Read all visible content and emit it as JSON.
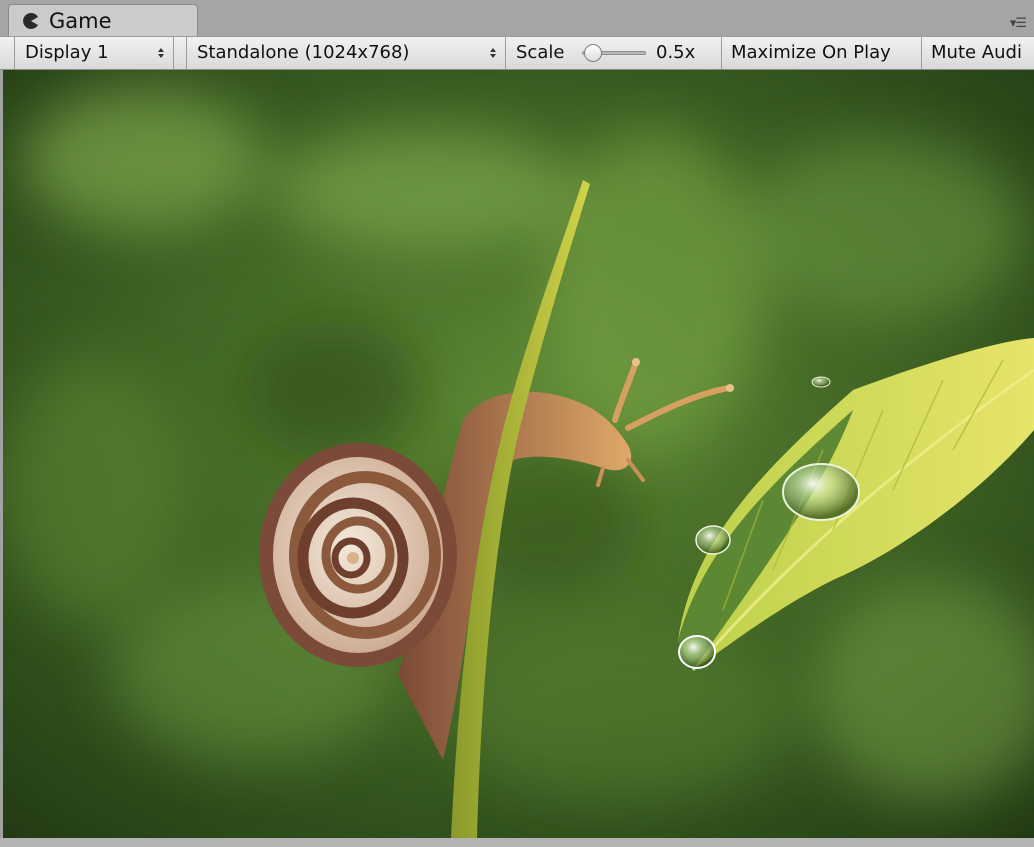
{
  "window": {
    "tab_label": "Game",
    "tab_icon": "pacman-icon",
    "tab_menu_icon": "tab-options-icon"
  },
  "toolbar": {
    "display_label": "Display 1",
    "aspect_label": "Standalone (1024x768)",
    "scale_label": "Scale",
    "scale_value": "0.5x",
    "scale_fraction": 0.0,
    "maximize_label": "Maximize On Play",
    "mute_label": "Mute Audi"
  },
  "viewport": {
    "content": "game-render-image",
    "background_color": "#3e5e22",
    "snail_shell_color": "#8b5a3c",
    "leaf_color": "#c9d65a"
  }
}
